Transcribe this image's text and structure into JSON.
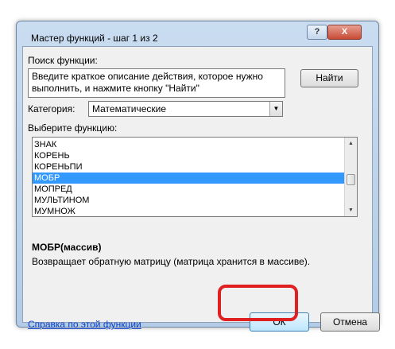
{
  "window": {
    "title": "Мастер функций - шаг 1 из 2",
    "help_glyph": "?",
    "close_glyph": "X"
  },
  "search": {
    "label": "Поиск функции:",
    "value": "Введите краткое описание действия, которое нужно выполнить, и нажмите кнопку \"Найти\"",
    "find_button": "Найти"
  },
  "category": {
    "label": "Категория:",
    "selected": "Математические"
  },
  "function_list": {
    "label": "Выберите функцию:",
    "items": [
      "ЗНАК",
      "КОРЕНЬ",
      "КОРЕНЬПИ",
      "МОБР",
      "МОПРЕД",
      "МУЛЬТИНОМ",
      "МУМНОЖ"
    ],
    "selected_index": 3
  },
  "selected_function": {
    "signature": "МОБР(массив)",
    "description": "Возвращает обратную матрицу (матрица хранится в массиве)."
  },
  "footer": {
    "help_link": "Справка по этой функции",
    "ok_button": "ОК",
    "cancel_button": "Отмена"
  },
  "colors": {
    "selection": "#3399ff",
    "highlight_ring": "#e02020",
    "link": "#0b41c6"
  }
}
